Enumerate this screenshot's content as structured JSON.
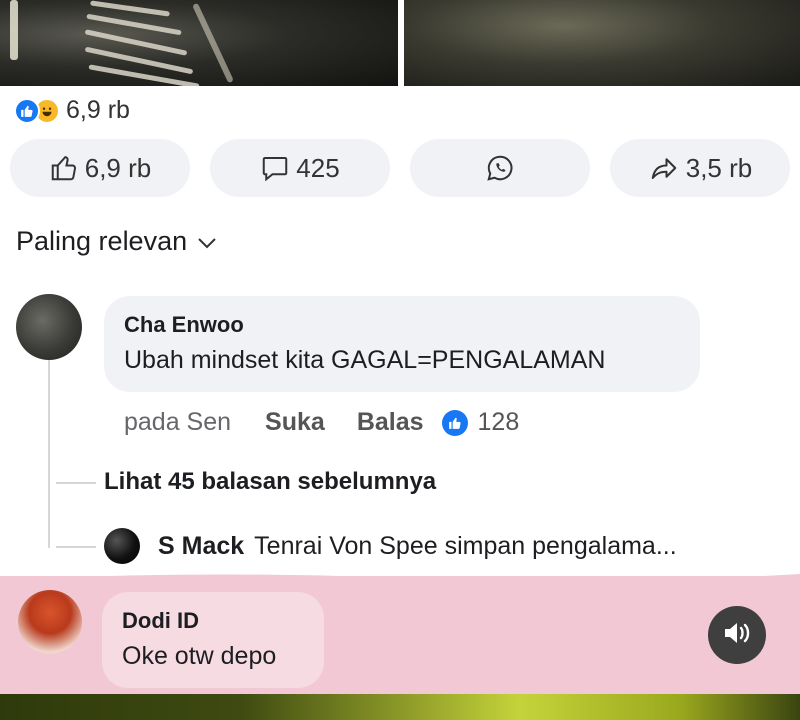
{
  "post": {
    "reaction_count": "6,9 rb",
    "actions": {
      "like_count": "6,9 rb",
      "comment_count": "425",
      "share_count": "3,5 rb"
    }
  },
  "comments": {
    "sort_label": "Paling relevan",
    "top": {
      "author": "Cha Enwoo",
      "text": "Ubah mindset kita GAGAL=PENGALAMAN",
      "time": "pada Sen",
      "like_label": "Suka",
      "reply_label": "Balas",
      "like_count": "128"
    },
    "view_more": "Lihat 45 balasan sebelumnya",
    "reply": {
      "author": "S Mack",
      "text": "Tenrai Von Spee simpan pengalama..."
    },
    "bottom": {
      "author": "Dodi ID",
      "text": "Oke otw depo"
    }
  },
  "colors": {
    "facebook_blue": "#1877f2",
    "bubble_grey": "#f0f2f5",
    "pink_overlay": "#f2c8d4"
  },
  "icons": [
    "like-reaction-icon",
    "haha-reaction-icon",
    "thumbs-up-icon",
    "comment-icon",
    "whatsapp-icon",
    "share-icon",
    "chevron-down-icon",
    "sound-icon"
  ]
}
